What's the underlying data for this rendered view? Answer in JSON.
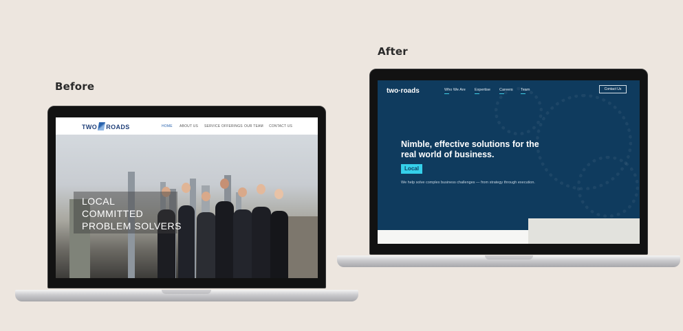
{
  "labels": {
    "before": "Before",
    "after": "After"
  },
  "before_site": {
    "logo_left": "TWO",
    "logo_right": "ROADS",
    "nav": [
      "HOME",
      "ABOUT US",
      "SERVICE OFFERINGS",
      "OUR TEAM",
      "CONTACT US"
    ],
    "active_nav": "HOME",
    "hero_lines": [
      "LOCAL",
      "COMMITTED",
      "PROBLEM SOLVERS"
    ]
  },
  "after_site": {
    "logo": "two·roads",
    "nav": [
      "Who We Are",
      "Expertise",
      "Careers",
      "Team"
    ],
    "contact_button": "Contact Us",
    "headline": "Nimble, effective solutions for the real world of business.",
    "tag": "Local",
    "subtext": "We help solve complex business challenges — from strategy through execution.",
    "colors": {
      "bg": "#0f3b5e",
      "accent": "#35d0ea"
    }
  }
}
